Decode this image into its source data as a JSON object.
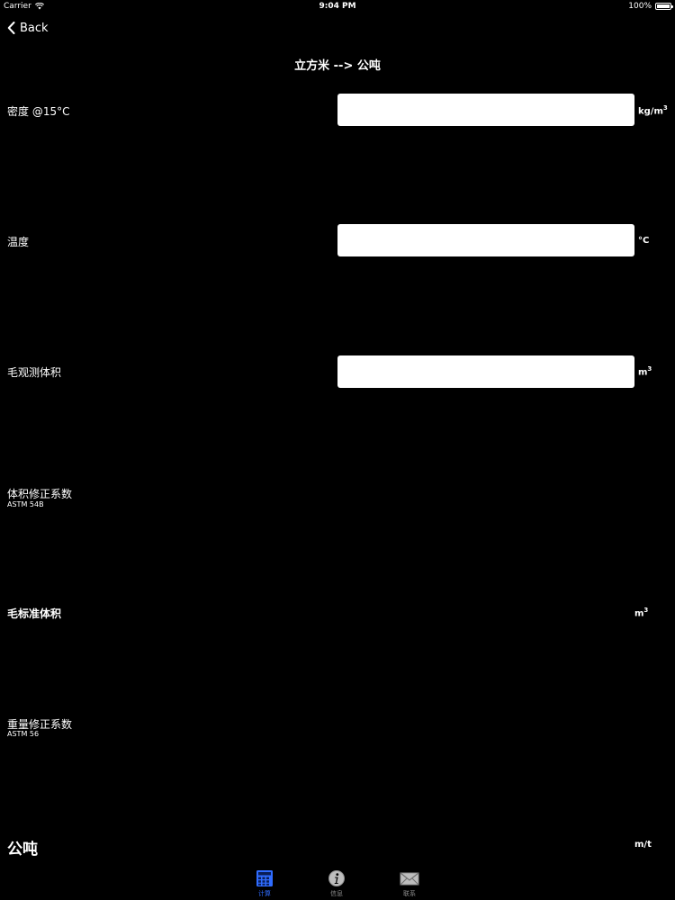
{
  "status_bar": {
    "carrier": "Carrier",
    "time": "9:04 PM",
    "battery": "100%",
    "battery_level": 1.0
  },
  "nav": {
    "back_label": "Back",
    "title": "立方米 --> 公吨"
  },
  "rows": {
    "density": {
      "label": "密度 @15°C",
      "value": "",
      "unit": "kg/m",
      "unit_sup": "3"
    },
    "temperature": {
      "label": "温度",
      "value": "",
      "unit": "°C"
    },
    "gross_observed_volume": {
      "label": "毛观测体积",
      "value": "",
      "unit": "m",
      "unit_sup": "3"
    },
    "vcf": {
      "label": "体积修正系数",
      "sub": "ASTM 54B"
    },
    "gross_standard_volume": {
      "label": "毛标准体积",
      "unit": "m",
      "unit_sup": "3"
    },
    "wcf": {
      "label": "重量修正系数",
      "sub": "ASTM 56"
    },
    "metric_tons": {
      "label": "公吨",
      "unit": "m/t"
    }
  },
  "tabs": [
    {
      "label": "计算",
      "icon": "calculator-icon",
      "active": true
    },
    {
      "label": "信息",
      "icon": "info-icon",
      "active": false
    },
    {
      "label": "联系",
      "icon": "mail-icon",
      "active": false
    }
  ],
  "colors": {
    "background": "#000000",
    "active_tab": "#2f6cff",
    "inactive_tab": "#8e8e8e"
  }
}
